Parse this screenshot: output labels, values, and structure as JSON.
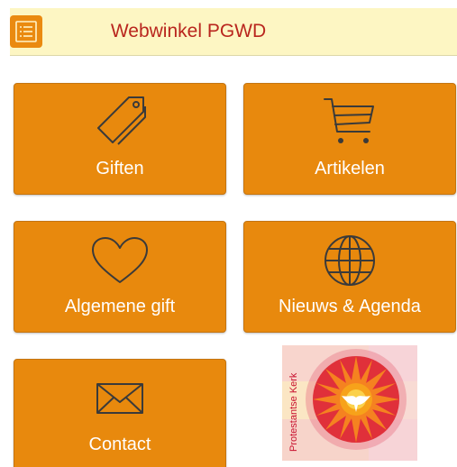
{
  "app": {
    "title": "Webwinkel PGWD"
  },
  "header": {
    "menu_icon": "list-menu-icon",
    "title": "Webwinkel PGWD"
  },
  "tiles": [
    {
      "label": "Giften",
      "icon": "price-tags-icon"
    },
    {
      "label": "Artikelen",
      "icon": "shopping-cart-icon"
    },
    {
      "label": "Algemene gift",
      "icon": "heart-icon"
    },
    {
      "label": "Nieuws & Agenda",
      "icon": "globe-icon"
    },
    {
      "label": "Contact",
      "icon": "envelope-icon"
    }
  ],
  "logo": {
    "text": "Protestantse Kerk",
    "icon": "protestantse-kerk-logo"
  },
  "colors": {
    "tile": "#e8890d",
    "header_bg": "#fdf6c3",
    "title": "#b9261e",
    "icon_stroke": "#3a3a3a"
  }
}
